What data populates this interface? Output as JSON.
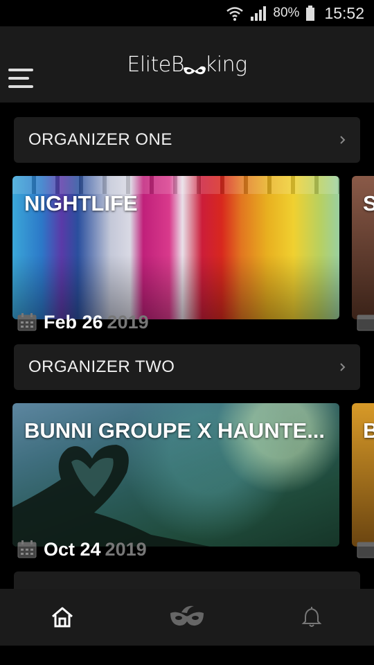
{
  "status_bar": {
    "battery": "80%",
    "time": "15:52",
    "icons": [
      "wifi-icon",
      "signal-icon",
      "battery-icon"
    ]
  },
  "app_bar": {
    "logo_left": "EliteB",
    "logo_right": "king",
    "icons": [
      "menu-icon",
      "mask-logo-icon"
    ]
  },
  "sections": [
    {
      "organizer": "ORGANIZER ONE",
      "events": [
        {
          "title": "NIGHTLIFE",
          "month_day": "Feb 26",
          "year": "2019"
        },
        {
          "title": "S"
        }
      ]
    },
    {
      "organizer": "ORGANIZER TWO",
      "events": [
        {
          "title": "BUNNI GROUPE X HAUNTE...",
          "month_day": "Oct 24",
          "year": "2019"
        },
        {
          "title": "B"
        }
      ]
    }
  ],
  "tabs": [
    {
      "icon": "home-icon",
      "active": true
    },
    {
      "icon": "mask-icon",
      "active": false
    },
    {
      "icon": "bell-icon",
      "active": false
    }
  ],
  "colors": {
    "background": "#000000",
    "bar": "#1b1b1b",
    "card": "#1d1d1d",
    "year_gray": "#777777"
  }
}
